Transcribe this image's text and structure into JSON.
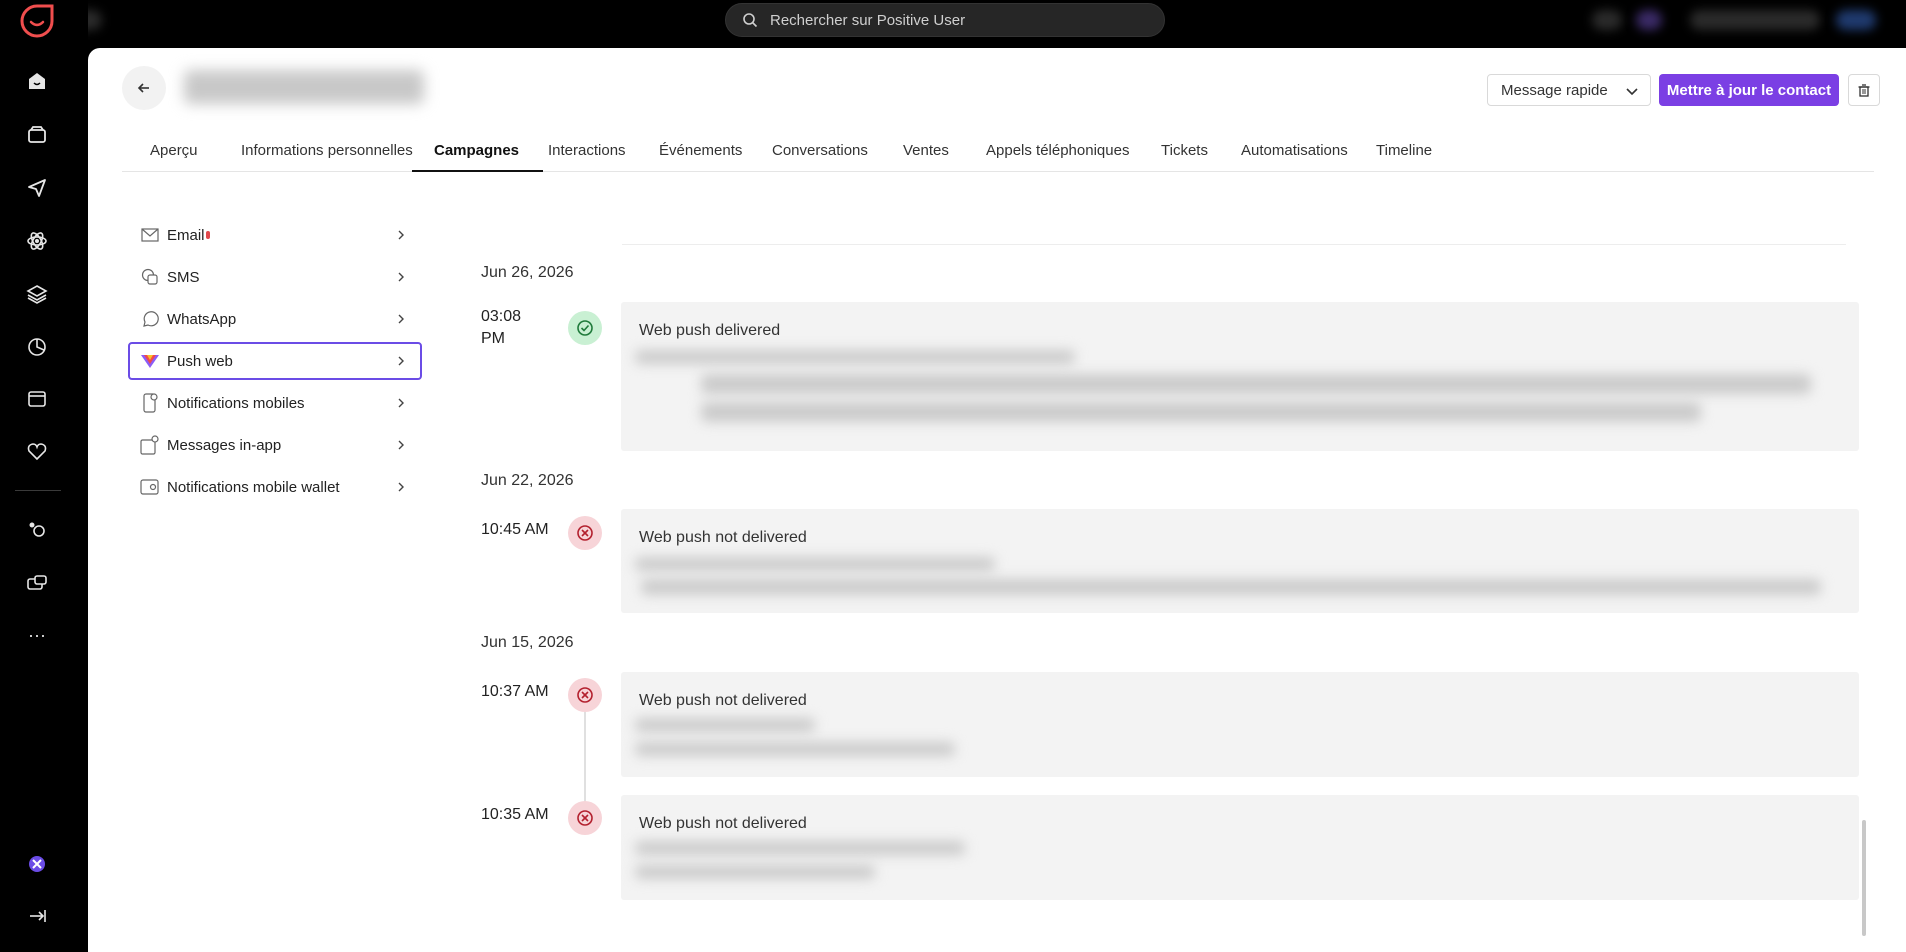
{
  "search": {
    "placeholder": "Rechercher sur Positive User"
  },
  "header": {
    "quick_message_label": "Message rapide",
    "update_contact_label": "Mettre à jour le contact"
  },
  "tabs": [
    {
      "label": "Aperçu"
    },
    {
      "label": "Informations personnelles"
    },
    {
      "label": "Campagnes",
      "active": true
    },
    {
      "label": "Interactions"
    },
    {
      "label": "Événements"
    },
    {
      "label": "Conversations"
    },
    {
      "label": "Ventes"
    },
    {
      "label": "Appels téléphoniques"
    },
    {
      "label": "Tickets"
    },
    {
      "label": "Automatisations"
    },
    {
      "label": "Timeline"
    }
  ],
  "channels": [
    {
      "label": "Email",
      "icon": "mail-icon"
    },
    {
      "label": "SMS",
      "icon": "sms-icon"
    },
    {
      "label": "WhatsApp",
      "icon": "whatsapp-icon"
    },
    {
      "label": "Push web",
      "icon": "push-web-icon",
      "active": true
    },
    {
      "label": "Notifications mobiles",
      "icon": "mobile-notification-icon"
    },
    {
      "label": "Messages in-app",
      "icon": "in-app-icon"
    },
    {
      "label": "Notifications mobile wallet",
      "icon": "wallet-icon"
    }
  ],
  "timeline": {
    "groups": [
      {
        "date": "Jun 26, 2026",
        "entries": [
          {
            "time": "03:08 PM",
            "status": "delivered",
            "title": "Web push delivered"
          }
        ]
      },
      {
        "date": "Jun 22, 2026",
        "entries": [
          {
            "time": "10:45 AM",
            "status": "not-delivered",
            "title": "Web push not delivered"
          }
        ]
      },
      {
        "date": "Jun 15, 2026",
        "entries": [
          {
            "time": "10:37 AM",
            "status": "not-delivered",
            "title": "Web push not delivered"
          },
          {
            "time": "10:35 AM",
            "status": "not-delivered",
            "title": "Web push not delivered"
          }
        ]
      }
    ]
  },
  "colors": {
    "accent": "#7b3fe4",
    "success_bg": "#c9f0d3",
    "failure_bg": "#f7d4d8"
  }
}
